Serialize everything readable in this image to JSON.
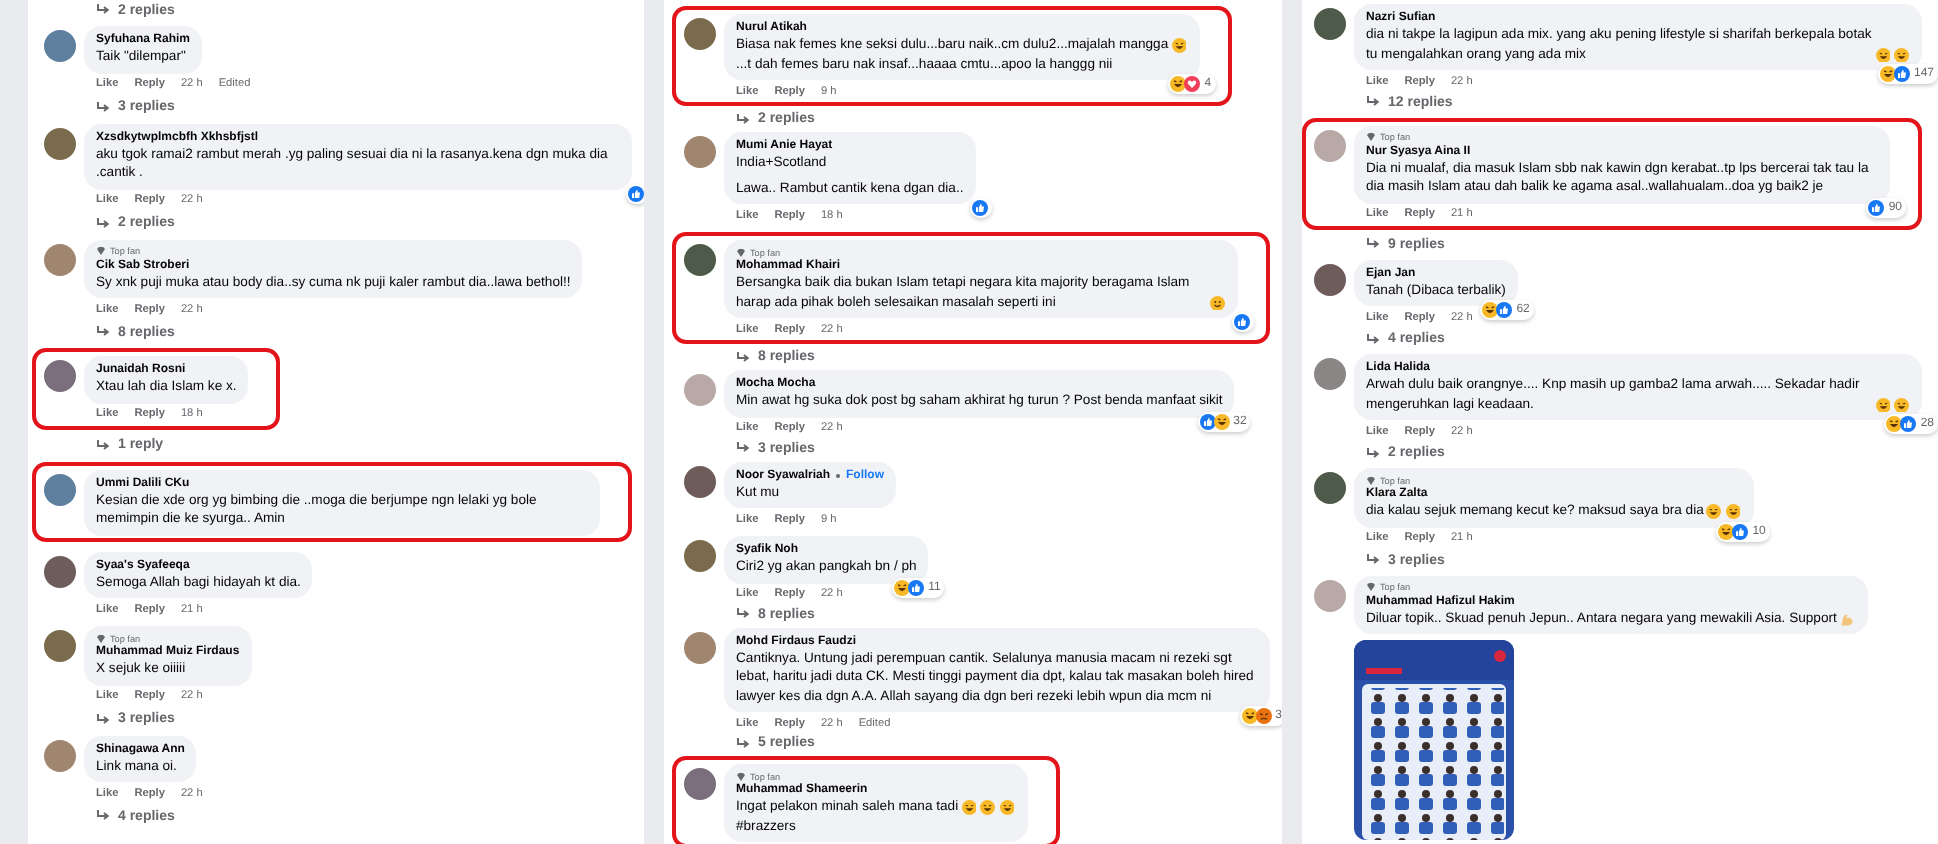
{
  "columns": [
    {
      "items": [
        {
          "kind": "replies",
          "label": "2 replies"
        },
        {
          "kind": "comment",
          "name": "Syfuhana Rahim",
          "highlighted": false,
          "text": [
            [
              [
                "Taik \"dilempar\""
              ]
            ]
          ],
          "actions": [
            "Like",
            "Reply"
          ],
          "time": "22 h",
          "edited": "Edited"
        },
        {
          "kind": "replies",
          "label": "3 replies"
        },
        {
          "kind": "comment",
          "name": "Xzsdkytwplmcbfh Xkhsbfjstl",
          "highlighted": false,
          "text": [
            [
              [
                "aku tgok ramai2 rambut merah .yg paling sesuai dia ni la rasanya.kena dgn muka dia .cantik ."
              ]
            ]
          ],
          "reactions": [
            {
              "kind": "like"
            }
          ],
          "actions": [
            "Like",
            "Reply"
          ],
          "time": "22 h"
        },
        {
          "kind": "replies",
          "label": "2 replies"
        },
        {
          "kind": "comment",
          "name": "Cik Sab Stroberi",
          "badge": "Top fan",
          "highlighted": false,
          "text": [
            [
              [
                "Sy xnk puji muka atau body dia..sy cuma nk puji kaler rambut dia..lawa bethol!!"
              ]
            ]
          ],
          "actions": [
            "Like",
            "Reply"
          ],
          "time": "22 h"
        },
        {
          "kind": "replies",
          "label": "8 replies"
        },
        {
          "kind": "comment",
          "name": "Junaidah Rosni",
          "highlighted": true,
          "text": [
            [
              [
                "Xtau lah dia Islam ke x."
              ]
            ]
          ],
          "actions": [
            "Like",
            "Reply"
          ],
          "time": "18 h"
        },
        {
          "kind": "replies",
          "label": "1 reply"
        },
        {
          "kind": "comment",
          "name": "Ummi Dalili CKu",
          "highlighted": true,
          "text": [
            [
              [
                "Kesian die xde org yg bimbing die ..moga die berjumpe ngn lelaki yg bole memimpin die ke syurga.. Amin"
              ]
            ]
          ]
        },
        {
          "kind": "comment",
          "name": "Syaa's Syafeeqa",
          "highlighted": false,
          "text": [
            [
              [
                "Semoga Allah bagi hidayah kt dia."
              ]
            ]
          ],
          "actions": [
            "Like",
            "Reply"
          ],
          "time": "21 h"
        },
        {
          "kind": "comment",
          "name": "Muhammad Muiz Firdaus",
          "badge": "Top fan",
          "highlighted": false,
          "text": [
            [
              [
                "X sejuk ke oiiiii"
              ]
            ]
          ],
          "actions": [
            "Like",
            "Reply"
          ],
          "time": "22 h"
        },
        {
          "kind": "replies",
          "label": "3 replies"
        },
        {
          "kind": "comment",
          "name": "Shinagawa Ann",
          "highlighted": false,
          "text": [
            [
              [
                "Link mana oi."
              ]
            ]
          ],
          "actions": [
            "Like",
            "Reply"
          ],
          "time": "22 h"
        },
        {
          "kind": "replies",
          "label": "4 replies"
        }
      ]
    },
    {
      "items": [
        {
          "kind": "comment",
          "name": "Nurul Atikah",
          "highlighted": true,
          "text": [
            [
              [
                "Biasa nak femes kne seksi dulu...baru naik..cm dulu2...majalah mangga",
                {
                  "kind": "laugh"
                }
              ],
              [
                "...t dah femes baru nak insaf...haaaa cmtu...apoo la hanggg nii"
              ]
            ]
          ],
          "reactions": [
            {
              "kind": "haha"
            },
            {
              "kind": "love"
            }
          ],
          "reaction_count": "4",
          "actions": [
            "Like",
            "Reply"
          ],
          "time": "9 h"
        },
        {
          "kind": "replies",
          "label": "2 replies"
        },
        {
          "kind": "comment",
          "name": "Mumi Anie Hayat",
          "highlighted": false,
          "text": [
            [
              [
                "India+Scotland"
              ]
            ],
            [
              [
                "Lawa.. Rambut cantik kena dgan dia.."
              ]
            ]
          ],
          "reactions": [
            {
              "kind": "like"
            }
          ],
          "actions": [
            "Like",
            "Reply"
          ],
          "time": "18 h"
        },
        {
          "kind": "comment",
          "name": "Mohammad Khairi",
          "badge": "Top fan",
          "highlighted": true,
          "text": [
            [
              [
                "Bersangka baik dia bukan Islam tetapi negara kita majority beragama Islam harap ada pihak boleh selesaikan masalah seperti ini",
                {
                  "kind": "smile"
                }
              ]
            ]
          ],
          "reactions": [
            {
              "kind": "like"
            }
          ],
          "actions": [
            "Like",
            "Reply"
          ],
          "time": "22 h"
        },
        {
          "kind": "replies",
          "label": "8 replies"
        },
        {
          "kind": "comment",
          "name": "Mocha Mocha",
          "highlighted": false,
          "text": [
            [
              [
                "Min awat hg suka dok post bg saham akhirat hg turun ? Post benda manfaat sikit"
              ]
            ]
          ],
          "reactions": [
            {
              "kind": "like"
            },
            {
              "kind": "haha"
            }
          ],
          "reaction_count": "32",
          "actions": [
            "Like",
            "Reply"
          ],
          "time": "22 h"
        },
        {
          "kind": "replies",
          "label": "3 replies"
        },
        {
          "kind": "comment",
          "name": "Noor Syawalriah",
          "follow": "Follow",
          "highlighted": false,
          "text": [
            [
              [
                "Kut mu"
              ]
            ]
          ],
          "actions": [
            "Like",
            "Reply"
          ],
          "time": "9 h"
        },
        {
          "kind": "comment",
          "name": "Syafik Noh",
          "highlighted": false,
          "text": [
            [
              [
                "Ciri2 yg akan pangkah bn / ph"
              ]
            ]
          ],
          "reactions": [
            {
              "kind": "haha"
            },
            {
              "kind": "like"
            }
          ],
          "reaction_count": "11",
          "actions": [
            "Like",
            "Reply"
          ],
          "time": "22 h"
        },
        {
          "kind": "replies",
          "label": "8 replies"
        },
        {
          "kind": "comment",
          "name": "Mohd Firdaus Faudzi",
          "highlighted": false,
          "text": [
            [
              [
                "Cantiknya. Untung jadi perempuan cantik. Selalunya manusia macam ni rezeki sgt lebat, haritu jadi duta CK. Mesti tinggi payment dia dpt, kalau tak masakan boleh hired lawyer kes dia dgn A.A. Allah sayang dia dgn beri rezeki lebih wpun dia mcm ni"
              ]
            ]
          ],
          "reactions": [
            {
              "kind": "haha"
            },
            {
              "kind": "angry"
            }
          ],
          "reaction_count": "3",
          "actions": [
            "Like",
            "Reply"
          ],
          "time": "22 h",
          "edited": "Edited"
        },
        {
          "kind": "replies",
          "label": "5 replies"
        },
        {
          "kind": "comment",
          "name": "Muhammad Shameerin",
          "badge": "Top fan",
          "highlighted": true,
          "text": [
            [
              [
                "Ingat pelakon minah saleh mana tadi",
                {
                  "kind": "laugh"
                },
                {
                  "kind": "laugh"
                },
                {
                  "kind": "laugh"
                }
              ],
              [
                "#brazzers"
              ]
            ]
          ]
        }
      ]
    },
    {
      "items": [
        {
          "kind": "comment",
          "name": "Nazri Sufian",
          "highlighted": false,
          "text": [
            [
              [
                "dia ni takpe la lagipun ada mix. yang aku pening lifestyle si sharifah berkepala botak tu mengalahkan orang yang ada mix",
                {
                  "kind": "laugh"
                },
                {
                  "kind": "laugh"
                }
              ]
            ]
          ],
          "reactions": [
            {
              "kind": "haha"
            },
            {
              "kind": "like"
            }
          ],
          "reaction_count": "147",
          "actions": [
            "Like",
            "Reply"
          ],
          "time": "22 h"
        },
        {
          "kind": "replies",
          "label": "12 replies"
        },
        {
          "kind": "comment",
          "name": "Nur Syasya Aina II",
          "badge": "Top fan",
          "highlighted": true,
          "text": [
            [
              [
                "Dia ni mualaf, dia masuk Islam sbb nak kawin dgn kerabat..tp lps bercerai tak tau la dia masih Islam atau dah balik ke agama asal..wallahualam..doa yg baik2 je"
              ]
            ]
          ],
          "reactions": [
            {
              "kind": "like"
            }
          ],
          "reaction_count": "90",
          "actions": [
            "Like",
            "Reply"
          ],
          "time": "21 h"
        },
        {
          "kind": "replies",
          "label": "9 replies"
        },
        {
          "kind": "comment",
          "name": "Ejan Jan",
          "highlighted": false,
          "text": [
            [
              [
                "Tanah (Dibaca terbalik)"
              ]
            ]
          ],
          "reactions": [
            {
              "kind": "haha"
            },
            {
              "kind": "like"
            }
          ],
          "reaction_count": "62",
          "actions": [
            "Like",
            "Reply"
          ],
          "time": "22 h"
        },
        {
          "kind": "replies",
          "label": "4 replies"
        },
        {
          "kind": "comment",
          "name": "Lida Halida",
          "highlighted": false,
          "text": [
            [
              [
                "Arwah dulu baik orangnye.... Knp masih up gamba2 lama arwah..... Sekadar hadir mengeruhkan lagi keadaan.",
                {
                  "kind": "laugh"
                },
                {
                  "kind": "laugh"
                }
              ]
            ]
          ],
          "reactions": [
            {
              "kind": "haha"
            },
            {
              "kind": "like"
            }
          ],
          "reaction_count": "28",
          "actions": [
            "Like",
            "Reply"
          ],
          "time": "22 h"
        },
        {
          "kind": "replies",
          "label": "2 replies"
        },
        {
          "kind": "comment",
          "name": "Klara Zalta",
          "badge": "Top fan",
          "highlighted": false,
          "text": [
            [
              [
                "dia kalau sejuk memang kecut ke? maksud saya bra dia",
                {
                  "kind": "laugh"
                },
                {
                  "kind": "laugh"
                }
              ]
            ]
          ],
          "reactions": [
            {
              "kind": "haha"
            },
            {
              "kind": "like"
            }
          ],
          "reaction_count": "10",
          "actions": [
            "Like",
            "Reply"
          ],
          "time": "21 h"
        },
        {
          "kind": "replies",
          "label": "3 replies"
        },
        {
          "kind": "comment",
          "name": "Muhammad Hafizul Hakim",
          "badge": "Top fan",
          "highlighted": false,
          "text": [
            [
              [
                "Diluar topik.. Skuad penuh Jepun.. Antara negara yang mewakili Asia. Support",
                {
                  "kind": "muscle"
                }
              ]
            ]
          ],
          "attachment": {
            "kind": "picture"
          }
        }
      ]
    }
  ]
}
